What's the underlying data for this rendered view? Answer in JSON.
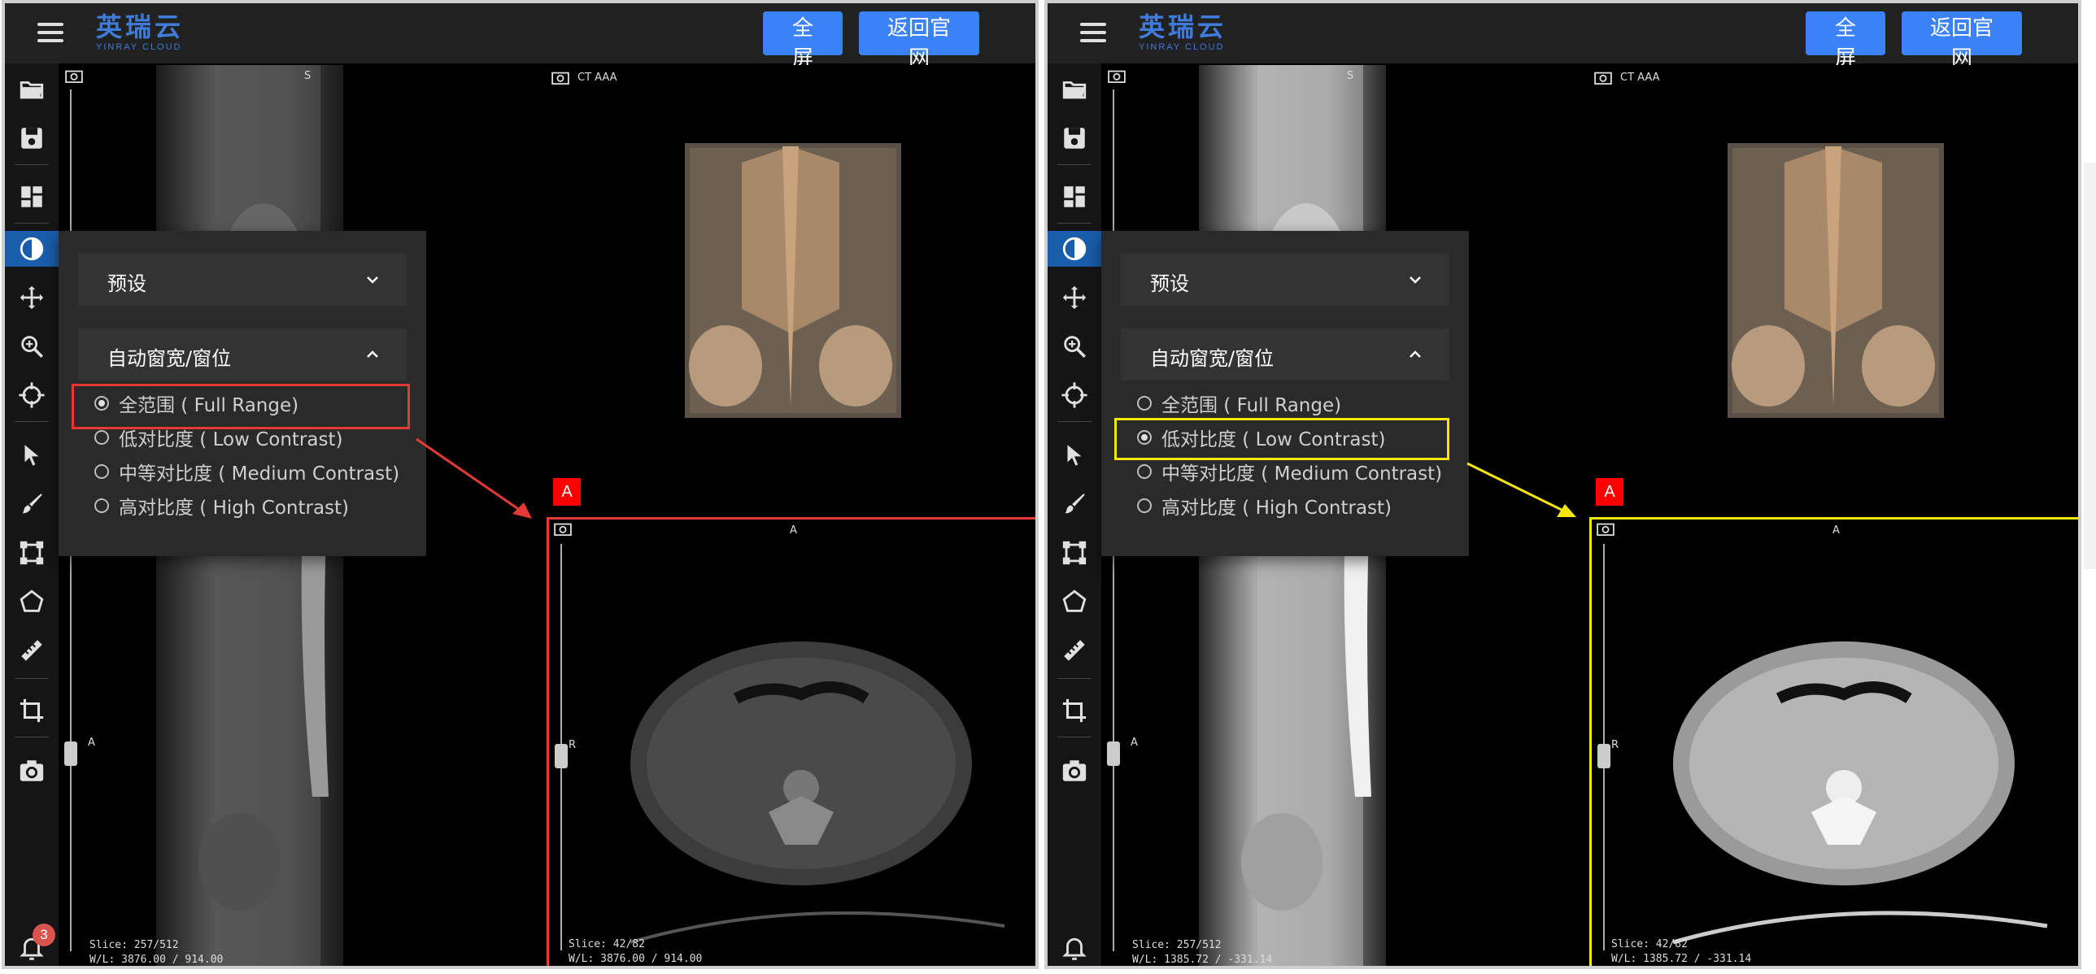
{
  "app": {
    "logo_text": "英瑞云",
    "logo_sub": "YINRAY CLOUD",
    "fullscreen_label": "全屏",
    "back_label": "返回官网"
  },
  "viewports": {
    "sagittal": {
      "top_orient": "S",
      "side_orient": "A",
      "slice": "Slice: 257/512"
    },
    "volume": {
      "label": "CT AAA",
      "orient_badge": "A"
    },
    "axial": {
      "top_orient": "A",
      "side_orient": "R",
      "slice": "Slice: 42/82"
    }
  },
  "left_panel": {
    "wl": "W/L: 3876.00 / 914.00",
    "notifications": "3",
    "selected": "全范围 ( Full Range)"
  },
  "right_panel": {
    "wl": "W/L: 1385.72 / -331.14",
    "selected": "低对比度 ( Low Contrast)"
  },
  "dropdown": {
    "preset_label": "预设",
    "auto_wl_label": "自动窗宽/窗位",
    "options": [
      "全范围 ( Full Range)",
      "低对比度 ( Low Contrast)",
      "中等对比度 ( Medium Contrast)",
      "高对比度 ( High Contrast)"
    ]
  },
  "colors": {
    "accent": "#3b82f6",
    "active_tool": "#1a5dab",
    "highlight_left": "#e53935",
    "highlight_right": "#f5e60a"
  }
}
